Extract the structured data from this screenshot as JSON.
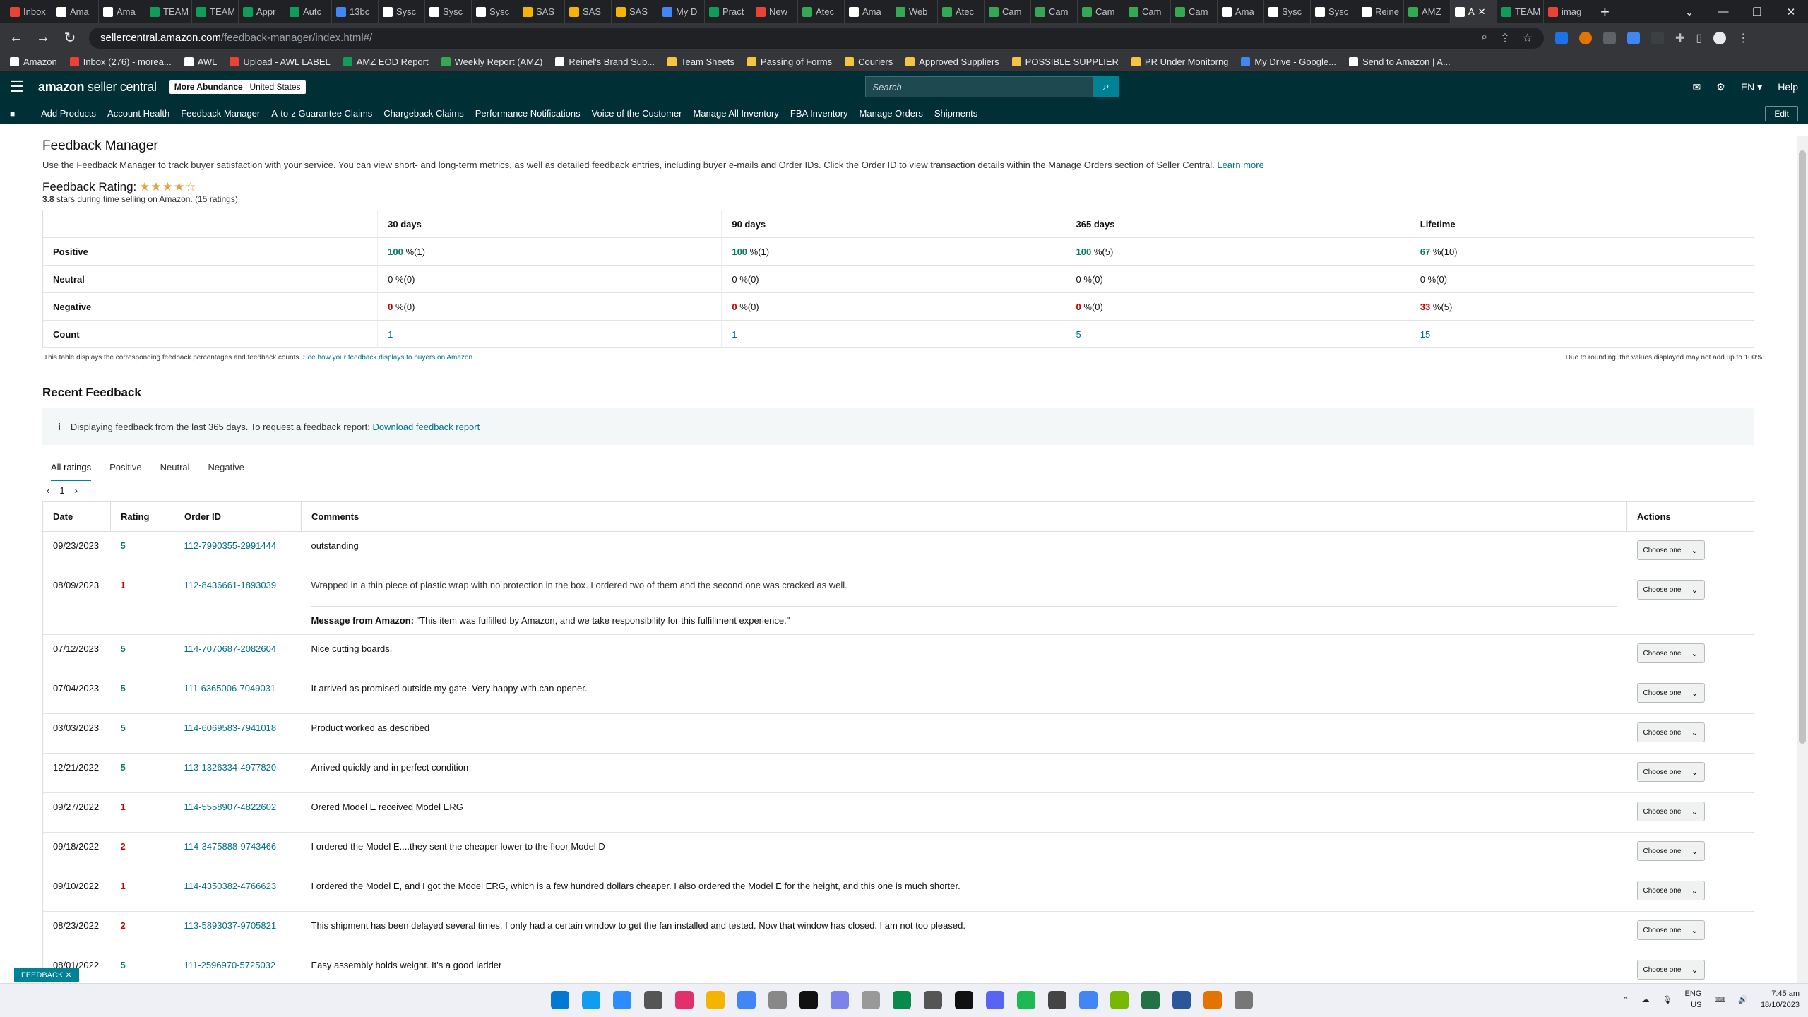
{
  "browser": {
    "tabs": [
      {
        "label": "Inbox",
        "color": "#ea4335"
      },
      {
        "label": "Ama",
        "color": "#fff"
      },
      {
        "label": "Ama",
        "color": "#fff"
      },
      {
        "label": "TEAM",
        "color": "#0f9d58"
      },
      {
        "label": "TEAM",
        "color": "#0f9d58"
      },
      {
        "label": "Appr",
        "color": "#0f9d58"
      },
      {
        "label": "Autc",
        "color": "#0f9d58"
      },
      {
        "label": "13bc",
        "color": "#4285f4"
      },
      {
        "label": "Sysc",
        "color": "#fff"
      },
      {
        "label": "Sysc",
        "color": "#fff"
      },
      {
        "label": "Sysc",
        "color": "#fff"
      },
      {
        "label": "SAS",
        "color": "#f4b400"
      },
      {
        "label": "SAS",
        "color": "#f4b400"
      },
      {
        "label": "SAS",
        "color": "#f4b400"
      },
      {
        "label": "My D",
        "color": "#4285f4"
      },
      {
        "label": "Pract",
        "color": "#0f9d58"
      },
      {
        "label": "New",
        "color": "#ea4335"
      },
      {
        "label": "Atec",
        "color": "#34a853"
      },
      {
        "label": "Ama",
        "color": "#fff"
      },
      {
        "label": "Web",
        "color": "#34a853"
      },
      {
        "label": "Atec",
        "color": "#34a853"
      },
      {
        "label": "Cam",
        "color": "#34a853"
      },
      {
        "label": "Cam",
        "color": "#34a853"
      },
      {
        "label": "Cam",
        "color": "#34a853"
      },
      {
        "label": "Cam",
        "color": "#34a853"
      },
      {
        "label": "Cam",
        "color": "#34a853"
      },
      {
        "label": "Ama",
        "color": "#fff"
      },
      {
        "label": "Sysc",
        "color": "#fff"
      },
      {
        "label": "Sysc",
        "color": "#fff"
      },
      {
        "label": "Reine",
        "color": "#fff"
      },
      {
        "label": "AMZ",
        "color": "#34a853"
      },
      {
        "label": "A",
        "color": "#fff",
        "active": true
      },
      {
        "label": "TEAM",
        "color": "#0f9d58"
      },
      {
        "label": "imag",
        "color": "#ea4335"
      }
    ],
    "url_host": "sellercentral.amazon.com",
    "url_path": "/feedback-manager/index.html#/",
    "bookmarks": [
      {
        "label": "Amazon",
        "color": "#fff"
      },
      {
        "label": "Inbox (276) - morea...",
        "color": "#ea4335"
      },
      {
        "label": "AWL",
        "color": "#fff"
      },
      {
        "label": "Upload - AWL LABEL",
        "color": "#ea4335"
      },
      {
        "label": "AMZ EOD Report",
        "color": "#0f9d58"
      },
      {
        "label": "Weekly Report (AMZ)",
        "color": "#34a853"
      },
      {
        "label": "Reinel's Brand Sub...",
        "color": "#fff"
      },
      {
        "label": "Team Sheets",
        "color": "#f4c542"
      },
      {
        "label": "Passing of Forms",
        "color": "#f4c542"
      },
      {
        "label": "Couriers",
        "color": "#f4c542"
      },
      {
        "label": "Approved Suppliers",
        "color": "#f4c542"
      },
      {
        "label": "POSSIBLE SUPPLIER",
        "color": "#f4c542"
      },
      {
        "label": "PR Under Monitorng",
        "color": "#f4c542"
      },
      {
        "label": "My Drive - Google...",
        "color": "#4285f4"
      },
      {
        "label": "Send to Amazon | A...",
        "color": "#fff"
      }
    ]
  },
  "header": {
    "logo_bold": "amazon",
    "logo_rest": " seller central",
    "store_name": "More Abundance",
    "store_region": "United States",
    "search_placeholder": "Search",
    "lang": "EN",
    "help": "Help"
  },
  "nav": {
    "items": [
      "Add Products",
      "Account Health",
      "Feedback Manager",
      "A-to-z Guarantee Claims",
      "Chargeback Claims",
      "Performance Notifications",
      "Voice of the Customer",
      "Manage All Inventory",
      "FBA Inventory",
      "Manage Orders",
      "Shipments"
    ],
    "edit": "Edit"
  },
  "page": {
    "title": "Feedback Manager",
    "description": "Use the Feedback Manager to track buyer satisfaction with your service. You can view short- and long-term metrics, as well as detailed feedback entries, including buyer e-mails and Order IDs. Click the Order ID to view transaction details within the Manage Orders section of Seller Central.",
    "learn_more": "Learn more",
    "rating_label": "Feedback Rating:",
    "stars": "★★★★☆",
    "rating_value": "3.8",
    "rating_suffix": " stars during time selling on Amazon. (",
    "rating_count": "15",
    "rating_end": " ratings)"
  },
  "metrics": {
    "headers": [
      "30 days",
      "90 days",
      "365 days",
      "Lifetime"
    ],
    "positive_label": "Positive",
    "positive": [
      [
        "100",
        " %(1)"
      ],
      [
        "100",
        " %(1)"
      ],
      [
        "100",
        " %(5)"
      ],
      [
        "67",
        " %(10)"
      ]
    ],
    "neutral_label": "Neutral",
    "neutral": [
      [
        "0",
        " %(0)"
      ],
      [
        "0",
        " %(0)"
      ],
      [
        "0",
        " %(0)"
      ],
      [
        "0",
        " %(0)"
      ]
    ],
    "negative_label": "Negative",
    "negative": [
      [
        "0",
        " %(0)"
      ],
      [
        "0",
        " %(0)"
      ],
      [
        "0",
        " %(0)"
      ],
      [
        "33",
        " %(5)"
      ]
    ],
    "count_label": "Count",
    "counts": [
      "1",
      "1",
      "5",
      "15"
    ],
    "note_left": "This table displays the corresponding feedback percentages and feedback counts.",
    "note_link": "See how your feedback displays to buyers on Amazon.",
    "note_right": "Due to rounding, the values displayed may not add up to 100%."
  },
  "recent": {
    "title": "Recent Feedback",
    "info_text": "Displaying feedback from the last 365 days. To request a feedback report:",
    "info_link": "Download feedback report",
    "tabs": [
      "All ratings",
      "Positive",
      "Neutral",
      "Negative"
    ],
    "page": "1",
    "columns": [
      "Date",
      "Rating",
      "Order ID",
      "Comments",
      "Actions"
    ],
    "choose": "Choose one",
    "rows": [
      {
        "date": "09/23/2023",
        "rating": "5",
        "order": "112-7990355-2991444",
        "comment": "outstanding"
      },
      {
        "date": "08/09/2023",
        "rating": "1",
        "order": "112-8436661-1893039",
        "comment": "Wrapped in a thin piece of plastic wrap with no protection in the box. I ordered two of them and the second one was cracked as well.",
        "struck": true,
        "amz_label": "Message from Amazon:",
        "amz_msg": "\"This item was fulfilled by Amazon, and we take responsibility for this fulfillment experience.\""
      },
      {
        "date": "07/12/2023",
        "rating": "5",
        "order": "114-7070687-2082604",
        "comment": "Nice cutting boards."
      },
      {
        "date": "07/04/2023",
        "rating": "5",
        "order": "111-6365006-7049031",
        "comment": "It arrived as promised outside my gate. Very happy with can opener."
      },
      {
        "date": "03/03/2023",
        "rating": "5",
        "order": "114-6069583-7941018",
        "comment": "Product worked as described"
      },
      {
        "date": "12/21/2022",
        "rating": "5",
        "order": "113-1326334-4977820",
        "comment": "Arrived quickly and in perfect condition"
      },
      {
        "date": "09/27/2022",
        "rating": "1",
        "order": "114-5558907-4822602",
        "comment": "Orered Model E received Model ERG"
      },
      {
        "date": "09/18/2022",
        "rating": "2",
        "order": "114-3475888-9743466",
        "comment": "I ordered the Model E....they sent the cheaper lower to the floor Model D"
      },
      {
        "date": "09/10/2022",
        "rating": "1",
        "order": "114-4350382-4766623",
        "comment": "I ordered the Model E, and I got the Model ERG, which is a few hundred dollars cheaper. I also ordered the Model E for the height, and this one is much shorter."
      },
      {
        "date": "08/23/2022",
        "rating": "2",
        "order": "113-5893037-9705821",
        "comment": "This shipment has been delayed several times. I only had a certain window to get the fan installed and tested. Now that window has closed. I am not too pleased."
      },
      {
        "date": "08/01/2022",
        "rating": "5",
        "order": "111-2596970-5725032",
        "comment": "Easy assembly holds weight. It's a good ladder"
      }
    ]
  },
  "feedback_tab": "FEEDBACK",
  "taskbar": {
    "lang": "ENG",
    "region": "US",
    "time": "7:45 am",
    "date": "18/10/2023"
  }
}
